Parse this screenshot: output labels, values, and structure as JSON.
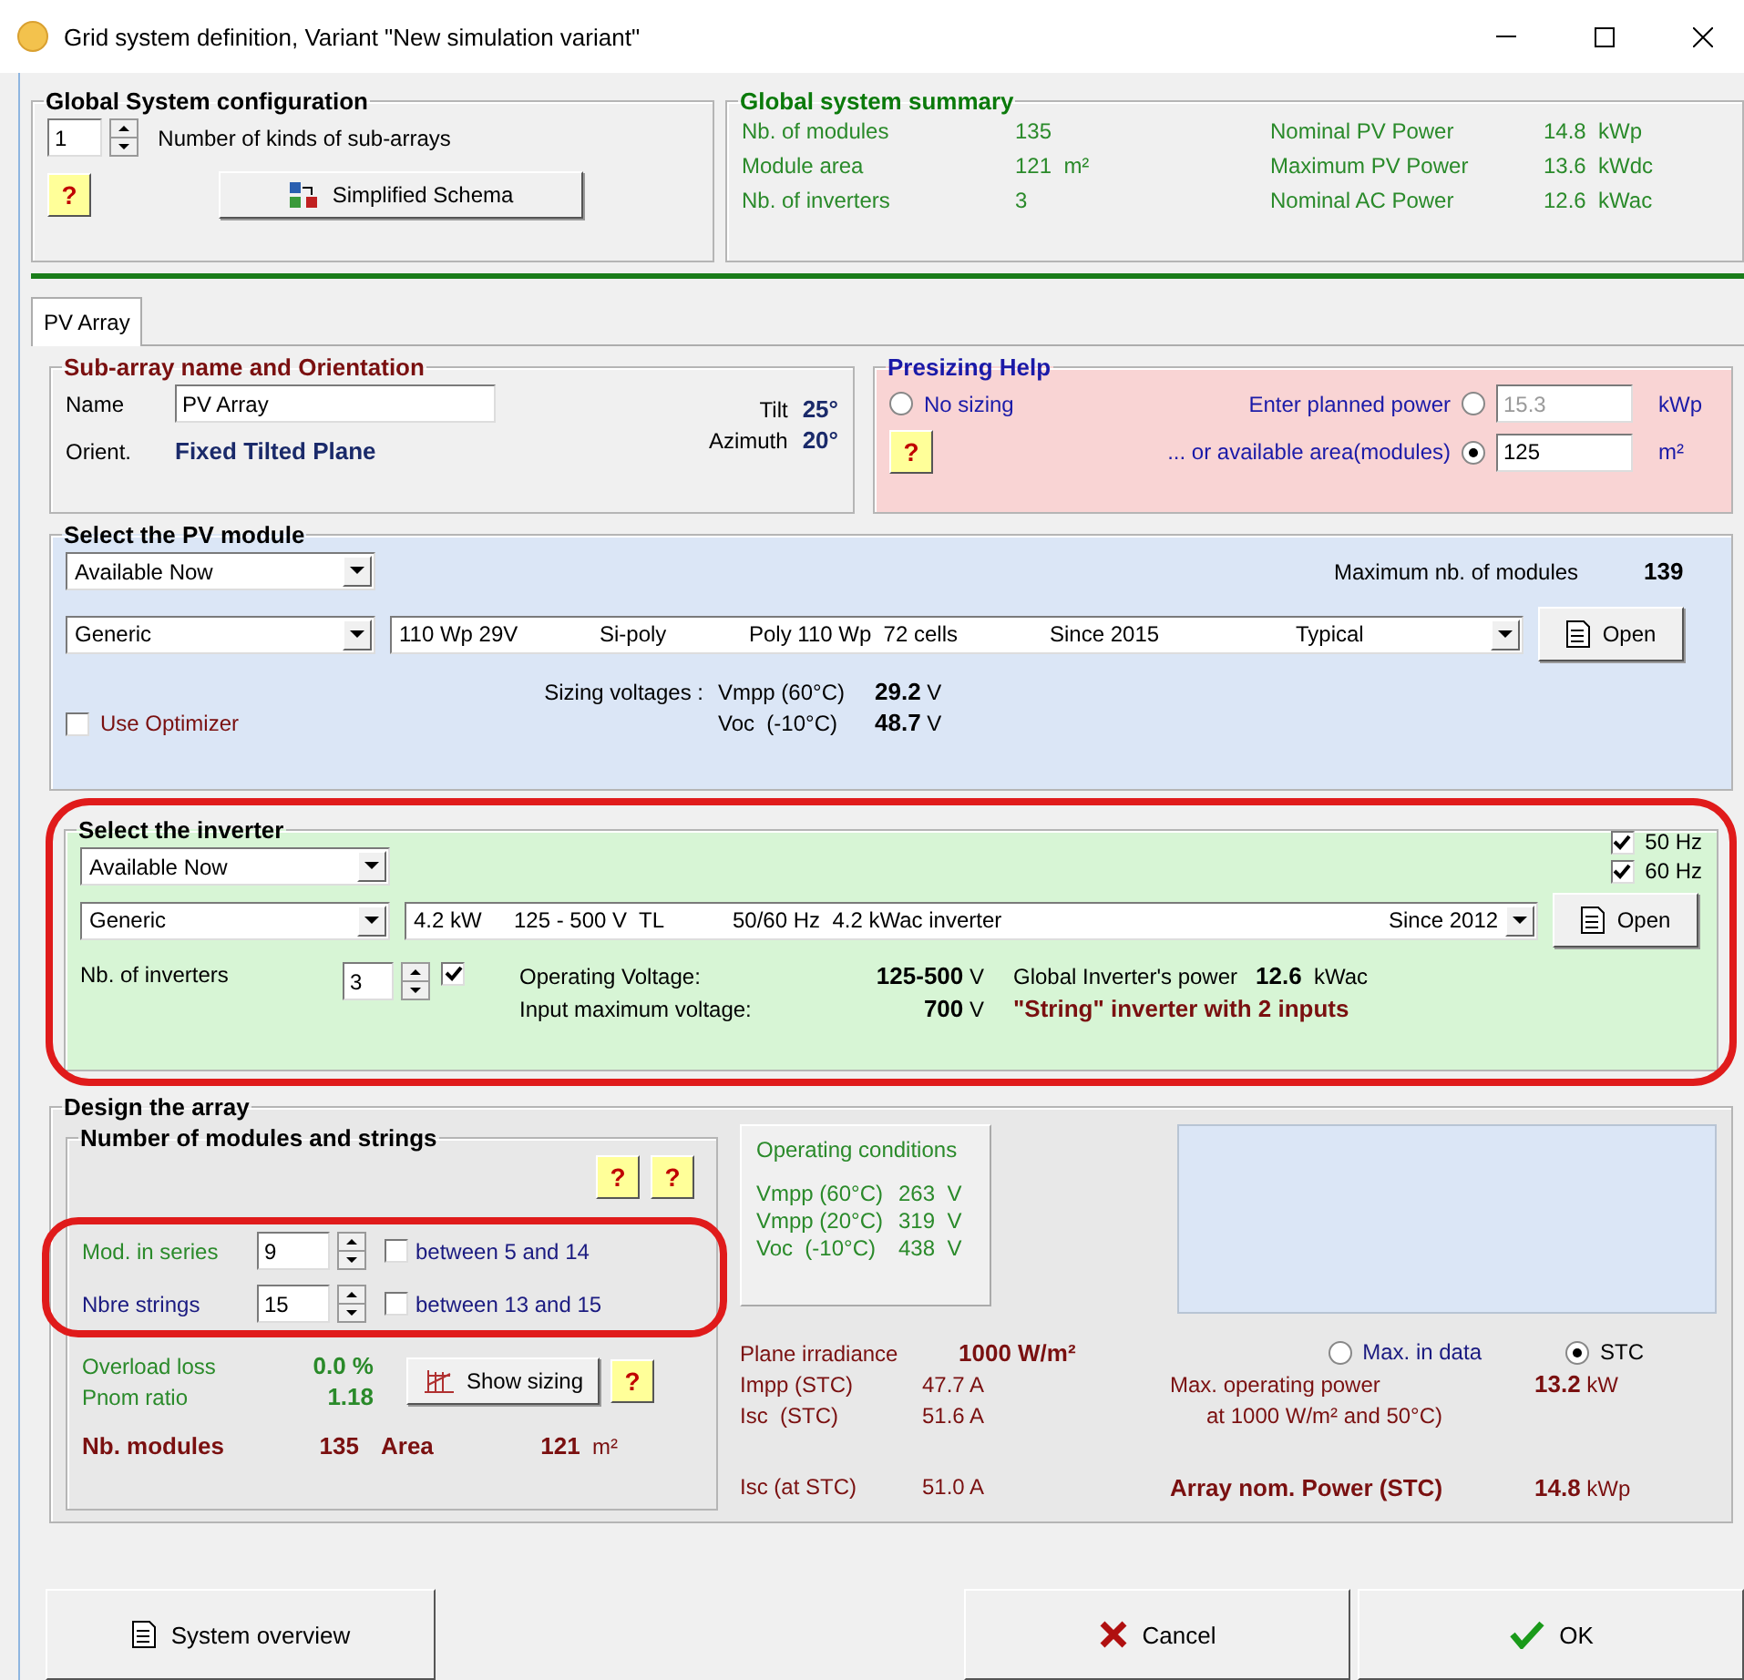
{
  "window": {
    "title": "Grid system definition, Variant  \"New simulation variant\""
  },
  "global_config": {
    "title": "Global System configuration",
    "kinds_value": "1",
    "kinds_label": "Number of kinds of sub-arrays",
    "help": "?",
    "schema_button": "Simplified Schema"
  },
  "summary": {
    "title": "Global system summary",
    "rows": [
      {
        "label": "Nb. of modules",
        "value": "135",
        "label2": "Nominal PV Power",
        "value2": "14.8  kWp"
      },
      {
        "label": "Module area",
        "value": "121  m²",
        "label2": "Maximum PV Power",
        "value2": "13.6  kWdc"
      },
      {
        "label": "Nb. of inverters",
        "value": "3",
        "label2": "Nominal AC Power",
        "value2": "12.6  kWac"
      }
    ]
  },
  "tabs": [
    {
      "label": "PV Array",
      "selected": true
    }
  ],
  "orientation": {
    "title": "Sub-array name and Orientation",
    "name_label": "Name",
    "name_value": "PV Array",
    "orient_label": "Orient.",
    "orient_value": "Fixed Tilted Plane",
    "tilt_label": "Tilt",
    "tilt_value": "25°",
    "azimuth_label": "Azimuth",
    "azimuth_value": "20°"
  },
  "presizing": {
    "title": "Presizing Help",
    "help": "?",
    "options": [
      {
        "label": "No sizing",
        "selected": false
      },
      {
        "label": "Enter planned power",
        "selected": false,
        "value": "15.3",
        "unit": "kWp"
      },
      {
        "label": "... or available area(modules)",
        "selected": true,
        "value": "125",
        "unit": "m²"
      }
    ]
  },
  "pv_module": {
    "title": "Select the PV module",
    "availability": "Available Now",
    "max_label": "Maximum nb. of modules",
    "max_value": "139",
    "manufacturer": "Generic",
    "model_parts": [
      "110 Wp 29V",
      "Si-poly",
      "Poly 110 Wp  72 cells",
      "Since 2015",
      "Typical"
    ],
    "open": "Open",
    "optimizer": {
      "label": "Use Optimizer",
      "checked": false
    },
    "sizing_label": "Sizing voltages :",
    "voltages": [
      {
        "label": "Vmpp (60°C)",
        "value": "29.2",
        "unit": "V"
      },
      {
        "label": "Voc  (-10°C)",
        "value": "48.7",
        "unit": "V"
      }
    ]
  },
  "inverter": {
    "title": "Select the inverter",
    "availability": "Available Now",
    "frequencies": [
      {
        "label": "50 Hz",
        "checked": true
      },
      {
        "label": "60 Hz",
        "checked": true
      }
    ],
    "manufacturer": "Generic",
    "model_parts": [
      "4.2 kW",
      "125 - 500 V  TL",
      "50/60 Hz  4.2 kWac inverter",
      "Since 2012"
    ],
    "open": "Open",
    "count_label": "Nb. of inverters",
    "count_value": "3",
    "count_checked": true,
    "voltages": [
      {
        "label": "Operating Voltage:",
        "value": "125-500",
        "unit": "V"
      },
      {
        "label": "Input maximum voltage:",
        "value": "700",
        "unit": "V"
      }
    ],
    "power_label": "Global Inverter's power",
    "power_value": "12.6",
    "power_unit": "kWac",
    "note": "\"String\" inverter with 2 inputs"
  },
  "design": {
    "title": "Design the array",
    "strings_title": "Number of modules and strings",
    "help_buttons": [
      "?",
      "?"
    ],
    "inputs": [
      {
        "label": "Mod. in series",
        "value": "9",
        "range": "between 5 and 14",
        "checked": false
      },
      {
        "label": "Nbre strings",
        "value": "15",
        "range": "between 13 and 15",
        "checked": false
      }
    ],
    "overload_label": "Overload loss",
    "overload_value": "0.0 %",
    "pnom_label": "Pnom ratio",
    "pnom_value": "1.18",
    "show_sizing": "Show sizing",
    "help": "?",
    "totals": [
      {
        "label": "Nb. modules",
        "value": "135"
      },
      {
        "label": "Area",
        "value": "121",
        "unit": "m²"
      }
    ],
    "operating": {
      "title": "Operating conditions",
      "rows": [
        {
          "label": "Vmpp (60°C)",
          "value": "263  V"
        },
        {
          "label": "Vmpp (20°C)",
          "value": "319  V"
        },
        {
          "label": "Voc  (-10°C)",
          "value": "438  V"
        }
      ]
    },
    "irradiance_label": "Plane irradiance",
    "irradiance_value": "1000 W/m²",
    "currents": [
      {
        "label": "Impp (STC)",
        "value": "47.7 A"
      },
      {
        "label": "Isc  (STC)",
        "value": "51.6 A"
      }
    ],
    "isc_at": {
      "label": "Isc (at STC)",
      "value": "51.0 A"
    },
    "modes": [
      {
        "label": "Max. in data",
        "selected": false
      },
      {
        "label": "STC",
        "selected": true
      }
    ],
    "max_power_label": "Max. operating power",
    "max_power_value": "13.2",
    "max_power_unit": "kW",
    "max_power_note": "at 1000 W/m² and 50°C)",
    "nominal_label": "Array nom. Power (STC)",
    "nominal_value": "14.8",
    "nominal_unit": "kWp"
  },
  "buttons": [
    {
      "kind": "overview",
      "label": "System overview"
    },
    {
      "kind": "cancel",
      "label": "Cancel"
    },
    {
      "kind": "ok",
      "label": "OK"
    }
  ]
}
